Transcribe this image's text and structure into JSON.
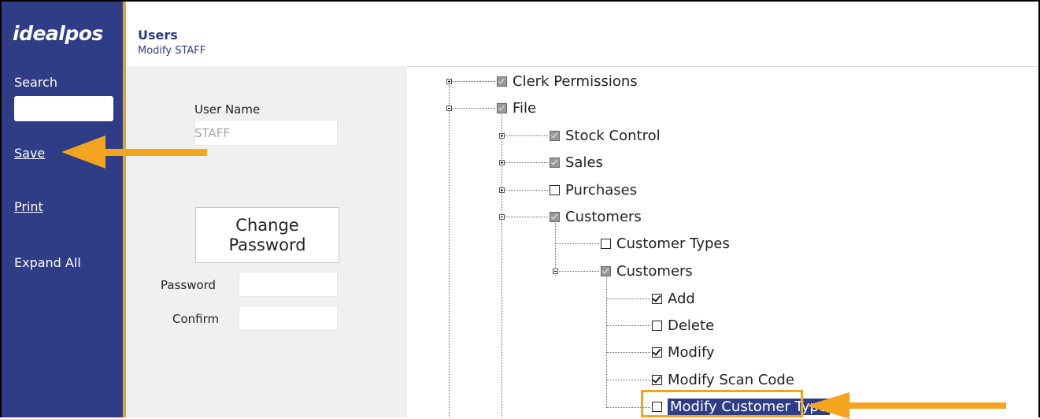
{
  "app": {
    "logo": "idealpos"
  },
  "header": {
    "title": "Users",
    "subtitle": "Modify STAFF"
  },
  "sidebar": {
    "search_label": "Search",
    "search_value": "",
    "save_label": "Save",
    "print_label": "Print",
    "expand_all_label": "Expand All"
  },
  "form": {
    "user_name_label": "User Name",
    "user_name_value": "STAFF",
    "change_password_line1": "Change",
    "change_password_line2": "Password",
    "password_label": "Password",
    "confirm_label": "Confirm"
  },
  "tree": {
    "items": [
      {
        "label": "Clerk Permissions",
        "state": "indeterminate",
        "expander": "plus"
      },
      {
        "label": "File",
        "state": "indeterminate",
        "expander": "minus"
      },
      {
        "label": "Stock Control",
        "state": "indeterminate",
        "expander": "plus"
      },
      {
        "label": "Sales",
        "state": "indeterminate",
        "expander": "plus"
      },
      {
        "label": "Purchases",
        "state": "unchecked",
        "expander": "plus"
      },
      {
        "label": "Customers",
        "state": "indeterminate",
        "expander": "minus"
      },
      {
        "label": "Customer Types",
        "state": "unchecked",
        "expander": "none"
      },
      {
        "label": "Customers",
        "state": "indeterminate",
        "expander": "minus"
      },
      {
        "label": "Add",
        "state": "checked",
        "expander": "none"
      },
      {
        "label": "Delete",
        "state": "unchecked",
        "expander": "none"
      },
      {
        "label": "Modify",
        "state": "checked",
        "expander": "none"
      },
      {
        "label": "Modify Scan Code",
        "state": "checked",
        "expander": "none"
      },
      {
        "label": "Modify Customer Type",
        "state": "unchecked",
        "expander": "none",
        "selected": true
      }
    ]
  },
  "colors": {
    "sidebar": "#2f3d86",
    "accent": "#f4a520",
    "selection": "#2f3d86"
  }
}
